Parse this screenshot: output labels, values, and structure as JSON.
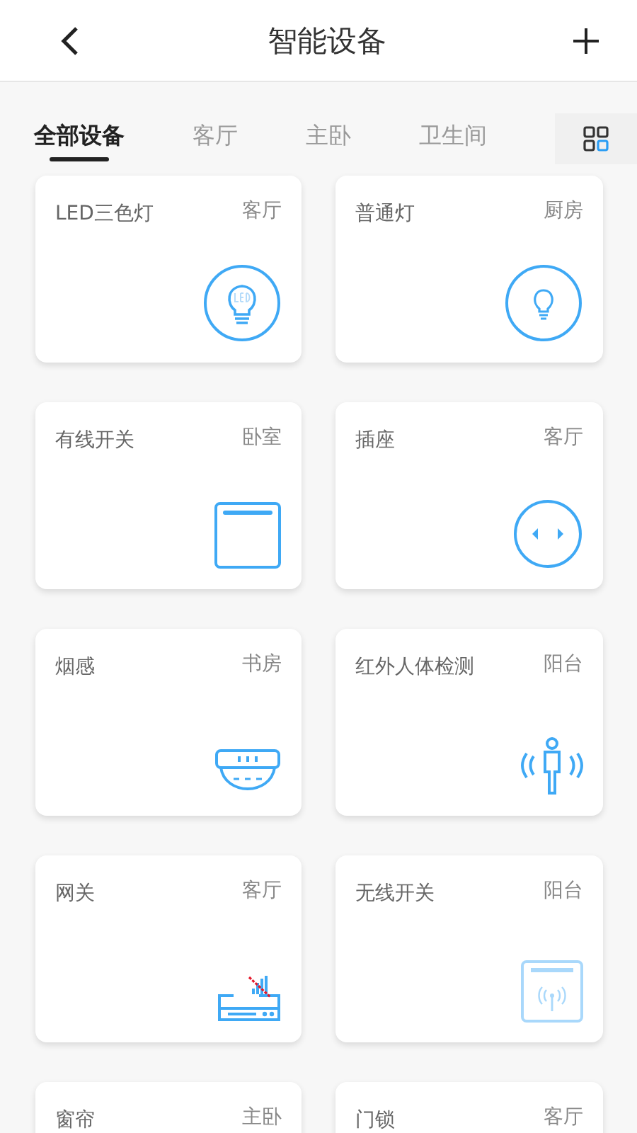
{
  "header": {
    "title": "智能设备"
  },
  "tabs": [
    {
      "label": "全部设备",
      "selected": true
    },
    {
      "label": "客厅",
      "selected": false
    },
    {
      "label": "主卧",
      "selected": false
    },
    {
      "label": "卫生间",
      "selected": false
    }
  ],
  "devices": [
    {
      "name": "LED三色灯",
      "room": "客厅",
      "kind": "led-bulb"
    },
    {
      "name": "普通灯",
      "room": "厨房",
      "kind": "bulb"
    },
    {
      "name": "有线开关",
      "room": "卧室",
      "kind": "wired-switch"
    },
    {
      "name": "插座",
      "room": "客厅",
      "kind": "socket"
    },
    {
      "name": "烟感",
      "room": "书房",
      "kind": "smoke"
    },
    {
      "name": "红外人体检测",
      "room": "阳台",
      "kind": "motion"
    },
    {
      "name": "网关",
      "room": "客厅",
      "kind": "gateway"
    },
    {
      "name": "无线开关",
      "room": "阳台",
      "kind": "wireless-switch"
    },
    {
      "name": "窗帘",
      "room": "主卧"
    },
    {
      "name": "门锁",
      "room": "客厅"
    }
  ]
}
